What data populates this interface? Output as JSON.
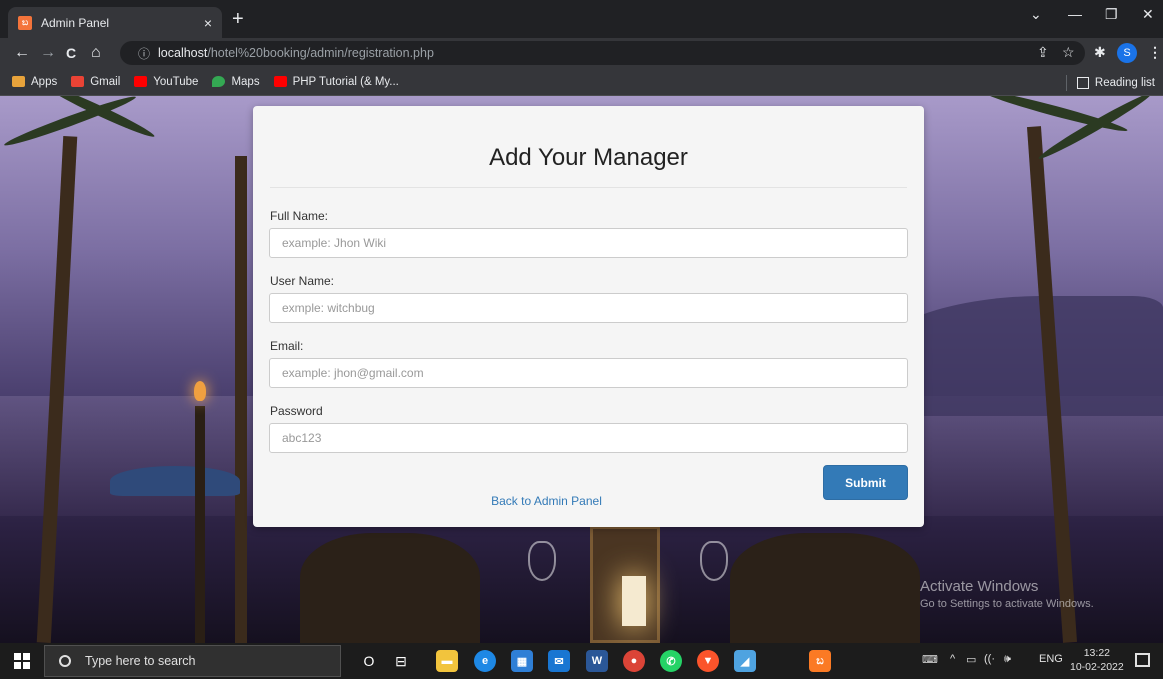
{
  "browser": {
    "tab_title": "Admin Panel",
    "tab_close": "×",
    "new_tab": "+",
    "win_min": "—",
    "win_restore": "❐",
    "win_close": "✕",
    "win_dropdown": "⌄",
    "back": "←",
    "forward": "→",
    "reload": "C",
    "home": "⌂",
    "url_host": "localhost",
    "url_path": "/hotel%20booking/admin/registration.php",
    "info_icon": "ⓘ",
    "share_icon": "⇪",
    "star_icon": "☆",
    "ext_icon": "✱",
    "profile_initial": "S",
    "menu_icon": "⋮"
  },
  "bookmarks": {
    "items": [
      {
        "label": "Apps",
        "color": "#e8a33b"
      },
      {
        "label": "Gmail",
        "color": "#ea4335"
      },
      {
        "label": "YouTube",
        "color": "#ff0000"
      },
      {
        "label": "Maps",
        "color": "#34a853"
      },
      {
        "label": "PHP Tutorial (& My...",
        "color": "#ff0000"
      }
    ],
    "reading_list": "Reading list"
  },
  "form": {
    "title": "Add Your Manager",
    "fields": [
      {
        "label": "Full Name:",
        "placeholder": "example: Jhon Wiki"
      },
      {
        "label": "User Name:",
        "placeholder": "exmple: witchbug"
      },
      {
        "label": "Email:",
        "placeholder": "example: jhon@gmail.com"
      },
      {
        "label": "Password",
        "placeholder": "abc123"
      }
    ],
    "submit_label": "Submit",
    "back_link": "Back to Admin Panel"
  },
  "watermark": {
    "line1": "Activate Windows",
    "line2": "Go to Settings to activate Windows."
  },
  "taskbar": {
    "search_placeholder": "Type here to search",
    "apps": [
      {
        "name": "cortana",
        "glyph": "O",
        "color": "transparent"
      },
      {
        "name": "task-view",
        "glyph": "⊟",
        "color": "transparent"
      },
      {
        "name": "file-explorer",
        "glyph": "▬",
        "color": "#f2c43d"
      },
      {
        "name": "edge",
        "glyph": "e",
        "color": "#1e88e5"
      },
      {
        "name": "store",
        "glyph": "▦",
        "color": "#2f7fd6"
      },
      {
        "name": "mail",
        "glyph": "✉",
        "color": "#1976d2"
      },
      {
        "name": "word",
        "glyph": "W",
        "color": "#2b5797"
      },
      {
        "name": "chrome",
        "glyph": "●",
        "color": "#db4437"
      },
      {
        "name": "whatsapp",
        "glyph": "✆",
        "color": "#25d366"
      },
      {
        "name": "brave",
        "glyph": "▼",
        "color": "#fb542b"
      },
      {
        "name": "app",
        "glyph": "◢",
        "color": "#4fa3e0"
      },
      {
        "name": "xampp",
        "glyph": "ಬ",
        "color": "#fb7a24"
      }
    ],
    "tray_keyboard": "⌨",
    "tray_up": "^",
    "tray_wifi": "((·",
    "tray_volume": "🕪",
    "language": "ENG",
    "time": "13:22",
    "date": "10-02-2022"
  }
}
